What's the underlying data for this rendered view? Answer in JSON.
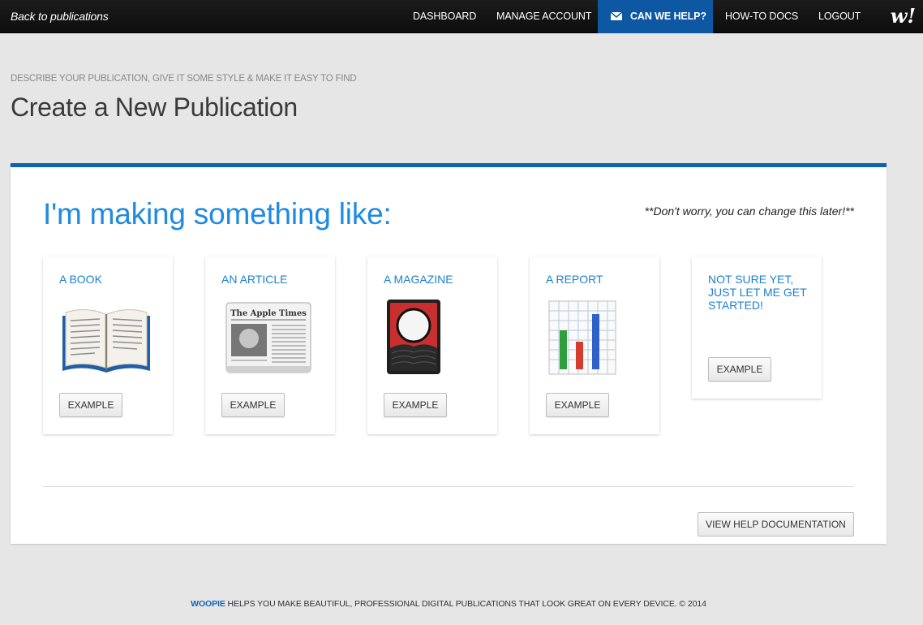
{
  "topbar": {
    "back_label": "Back to publications",
    "nav": [
      {
        "label": "DASHBOARD"
      },
      {
        "label": "MANAGE ACCOUNT"
      },
      {
        "label": "CAN WE HELP?"
      },
      {
        "label": "HOW-TO DOCS"
      },
      {
        "label": "LOGOUT"
      }
    ],
    "logo_text": "w!",
    "help_color": "#0d57a3"
  },
  "header": {
    "subheading": "DESCRIBE YOUR PUBLICATION, GIVE IT SOME STYLE & MAKE IT EASY TO FIND",
    "title": "Create a New Publication"
  },
  "panel": {
    "heading": "I'm making something like:",
    "note": "**Don't worry, you can change this later!**",
    "accent_color": "#0d64ae",
    "cards": [
      {
        "title": "A BOOK",
        "icon": "open-book-icon",
        "button": "EXAMPLE"
      },
      {
        "title": "AN ARTICLE",
        "icon": "newspaper-icon",
        "button": "EXAMPLE",
        "newspaper_masthead": "The Apple Times"
      },
      {
        "title": "A MAGAZINE",
        "icon": "magazine-icon",
        "button": "EXAMPLE"
      },
      {
        "title": "A REPORT",
        "icon": "bar-chart-icon",
        "button": "EXAMPLE"
      },
      {
        "title": "NOT SURE YET, JUST LET ME GET STARTED!",
        "button": "EXAMPLE"
      }
    ],
    "help_button": "VIEW HELP DOCUMENTATION"
  },
  "footer": {
    "brand": "WOOPIE",
    "text": " HELPS YOU MAKE BEAUTIFUL, PROFESSIONAL DIGITAL PUBLICATIONS THAT LOOK GREAT ON EVERY DEVICE. © 2014"
  }
}
